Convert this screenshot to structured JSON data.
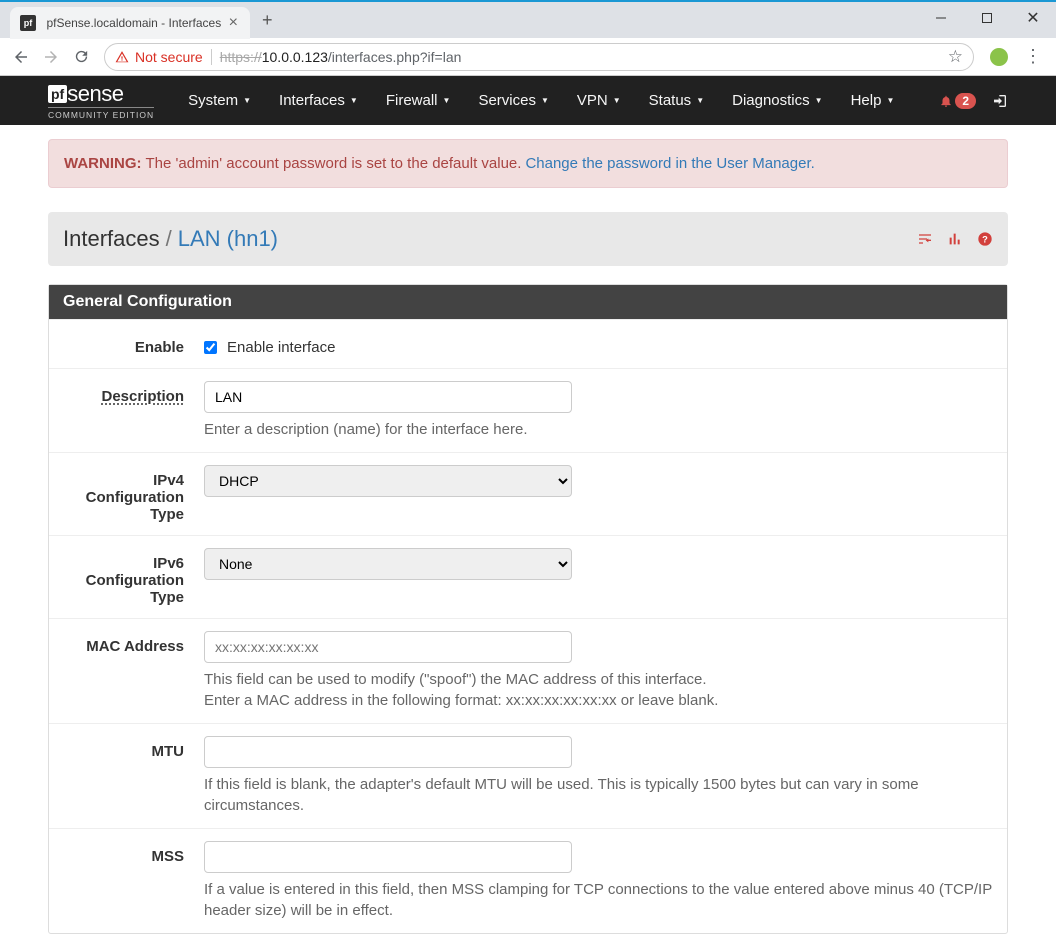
{
  "browser": {
    "tab_title": "pfSense.localdomain - Interfaces",
    "tab_favicon_text": "pf",
    "security_label": "Not secure",
    "url_https": "https://",
    "url_host": "10.0.0.123",
    "url_path": "/interfaces.php?if=lan"
  },
  "nav": {
    "logo_box": "pf",
    "logo_text": "sense",
    "logo_sub": "COMMUNITY EDITION",
    "menu": [
      "System",
      "Interfaces",
      "Firewall",
      "Services",
      "VPN",
      "Status",
      "Diagnostics",
      "Help"
    ],
    "notif_count": "2"
  },
  "alert": {
    "warning_label": "WARNING:",
    "warning_text": "The 'admin' account password is set to the default value.",
    "warning_link": "Change the password in the User Manager."
  },
  "breadcrumb": {
    "root": "Interfaces",
    "current": "LAN (hn1)"
  },
  "section": {
    "header": "General Configuration",
    "enable_label": "Enable",
    "enable_check_label": "Enable interface",
    "description_label": "Description",
    "description_value": "LAN",
    "description_help": "Enter a description (name) for the interface here.",
    "ipv4cfg_label": "IPv4 Configuration Type",
    "ipv4cfg_value": "DHCP",
    "ipv6cfg_label": "IPv6 Configuration Type",
    "ipv6cfg_value": "None",
    "mac_label": "MAC Address",
    "mac_placeholder": "xx:xx:xx:xx:xx:xx",
    "mac_help1": "This field can be used to modify (\"spoof\") the MAC address of this interface.",
    "mac_help2": "Enter a MAC address in the following format: xx:xx:xx:xx:xx:xx or leave blank.",
    "mtu_label": "MTU",
    "mtu_help": "If this field is blank, the adapter's default MTU will be used. This is typically 1500 bytes but can vary in some circumstances.",
    "mss_label": "MSS",
    "mss_help": "If a value is entered in this field, then MSS clamping for TCP connections to the value entered above minus 40 (TCP/IP header size) will be in effect."
  }
}
